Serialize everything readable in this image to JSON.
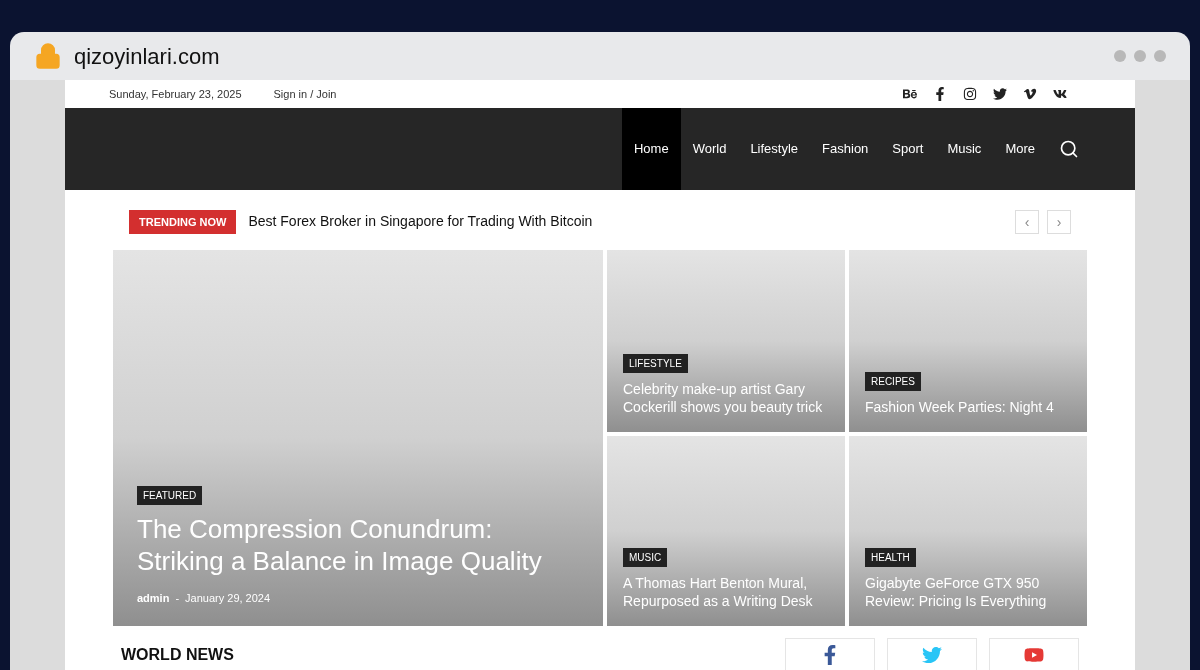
{
  "browser": {
    "address": "qizoyinlari.com"
  },
  "top_bar": {
    "date": "Sunday, February 23, 2025",
    "sign_in": "Sign in / Join"
  },
  "nav": [
    {
      "label": "Home",
      "selected": true
    },
    {
      "label": "World",
      "selected": false
    },
    {
      "label": "Lifestyle",
      "selected": false
    },
    {
      "label": "Fashion",
      "selected": false
    },
    {
      "label": "Sport",
      "selected": false
    },
    {
      "label": "Music",
      "selected": false
    },
    {
      "label": "More",
      "selected": false
    }
  ],
  "trending": {
    "badge": "TRENDING NOW",
    "headline": "Best Forex Broker in Singapore for Trading With Bitcoin",
    "prev": "‹",
    "next": "›"
  },
  "featured": {
    "category": "FEATURED",
    "title": "The Compression Conundrum: Striking a Balance in Image Quality",
    "author": "admin",
    "separator": "-",
    "date": "January 29, 2024"
  },
  "tiles": [
    {
      "category": "LIFESTYLE",
      "title": "Celebrity make-up artist Gary Cockerill shows you beauty trick"
    },
    {
      "category": "RECIPES",
      "title": "Fashion Week Parties: Night 4"
    },
    {
      "category": "MUSIC",
      "title": "A Thomas Hart Benton Mural, Repurposed as a Writing Desk"
    },
    {
      "category": "HEALTH",
      "title": "Gigabyte GeForce GTX 950 Review: Pricing Is Everything"
    }
  ],
  "section_heading": "WORLD NEWS"
}
